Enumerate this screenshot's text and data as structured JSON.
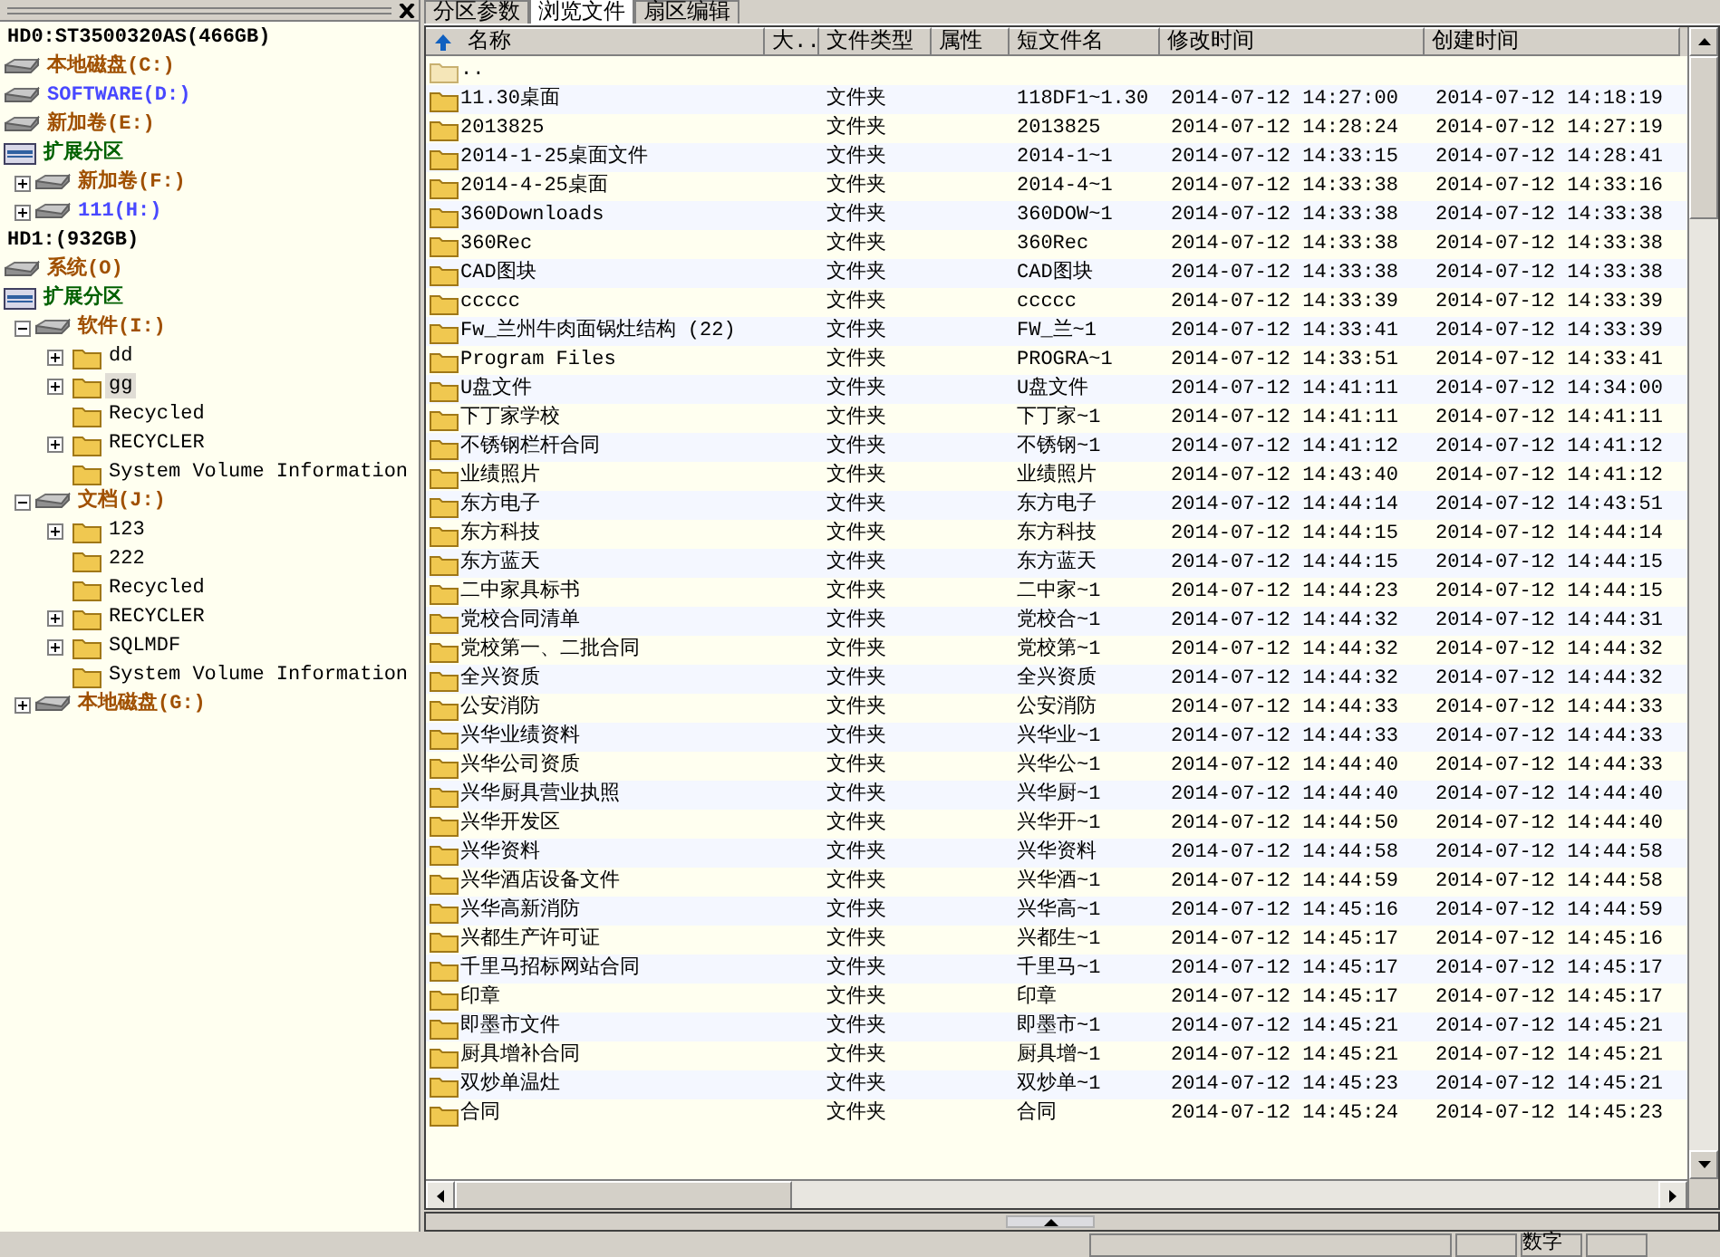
{
  "tree": {
    "items": [
      {
        "kind": "hdd",
        "label": "HD0:ST3500320AS(466GB)",
        "selected": false,
        "color": "#000000"
      },
      {
        "kind": "disk",
        "label": "本地磁盘(C:)",
        "selected": false,
        "color": "#a05000"
      },
      {
        "kind": "disk",
        "label": "SOFTWARE(D:)",
        "selected": false,
        "color": "#4848ff"
      },
      {
        "kind": "disk",
        "label": "新加卷(E:)",
        "selected": false,
        "color": "#a05000"
      },
      {
        "kind": "extended",
        "label": "扩展分区",
        "selected": false,
        "color": "#006000",
        "children": [
          {
            "kind": "disk",
            "label": "新加卷(F:)",
            "expanded": false,
            "selected": false,
            "color": "#a05000"
          },
          {
            "kind": "disk",
            "label": "111(H:)",
            "expanded": false,
            "selected": false,
            "color": "#4848ff"
          }
        ]
      },
      {
        "kind": "hdd",
        "label": "HD1:(932GB)",
        "selected": false,
        "color": "#000000"
      },
      {
        "kind": "disk",
        "label": "系统(O)",
        "selected": false,
        "color": "#a05000"
      },
      {
        "kind": "extended",
        "label": "扩展分区",
        "selected": false,
        "color": "#006000",
        "children": [
          {
            "kind": "disk",
            "label": "软件(I:)",
            "expanded": true,
            "selected": false,
            "color": "#a05000",
            "children": [
              {
                "kind": "folder",
                "label": "dd",
                "expanded": false,
                "selected": false,
                "color": "#000000"
              },
              {
                "kind": "folder",
                "label": "gg",
                "expanded": false,
                "selected": true,
                "color": "#000000"
              },
              {
                "kind": "folder",
                "label": "Recycled",
                "selected": false,
                "color": "#000000"
              },
              {
                "kind": "folder",
                "label": "RECYCLER",
                "expanded": false,
                "selected": false,
                "color": "#000000"
              },
              {
                "kind": "folder",
                "label": "System Volume Information",
                "selected": false,
                "color": "#000000"
              }
            ]
          },
          {
            "kind": "disk",
            "label": "文档(J:)",
            "expanded": true,
            "selected": false,
            "color": "#a05000",
            "children": [
              {
                "kind": "folder",
                "label": "123",
                "expanded": false,
                "selected": false,
                "color": "#000000"
              },
              {
                "kind": "folder",
                "label": "222",
                "selected": false,
                "color": "#000000"
              },
              {
                "kind": "folder",
                "label": "Recycled",
                "selected": false,
                "color": "#000000"
              },
              {
                "kind": "folder",
                "label": "RECYCLER",
                "expanded": false,
                "selected": false,
                "color": "#000000"
              },
              {
                "kind": "folder",
                "label": "SQLMDF",
                "expanded": false,
                "selected": false,
                "color": "#000000"
              },
              {
                "kind": "folder",
                "label": "System Volume Information",
                "selected": false,
                "color": "#000000"
              }
            ]
          },
          {
            "kind": "disk",
            "label": "本地磁盘(G:)",
            "expanded": false,
            "selected": false,
            "color": "#a05000"
          }
        ]
      }
    ]
  },
  "tabs": [
    {
      "label": "分区参数",
      "selected": false
    },
    {
      "label": "浏览文件",
      "selected": true
    },
    {
      "label": "扇区编辑",
      "selected": false
    }
  ],
  "table": {
    "columns": [
      "名称",
      "大..",
      "文件类型",
      "属性",
      "短文件名",
      "修改时间",
      "创建时间"
    ],
    "rows": [
      {
        "name": ".."
      },
      {
        "name": "11.30桌面",
        "type": "文件夹",
        "short": "118DF1~1.30",
        "modified": "2014-07-12 14:27:00",
        "created": "2014-07-12 14:18:19"
      },
      {
        "name": "2013825",
        "type": "文件夹",
        "short": "2013825",
        "modified": "2014-07-12 14:28:24",
        "created": "2014-07-12 14:27:19"
      },
      {
        "name": "2014-1-25桌面文件",
        "type": "文件夹",
        "short": "2014-1~1",
        "modified": "2014-07-12 14:33:15",
        "created": "2014-07-12 14:28:41"
      },
      {
        "name": "2014-4-25桌面",
        "type": "文件夹",
        "short": "2014-4~1",
        "modified": "2014-07-12 14:33:38",
        "created": "2014-07-12 14:33:16"
      },
      {
        "name": "360Downloads",
        "type": "文件夹",
        "short": "360DOW~1",
        "modified": "2014-07-12 14:33:38",
        "created": "2014-07-12 14:33:38"
      },
      {
        "name": "360Rec",
        "type": "文件夹",
        "short": "360Rec",
        "modified": "2014-07-12 14:33:38",
        "created": "2014-07-12 14:33:38"
      },
      {
        "name": "CAD图块",
        "type": "文件夹",
        "short": "CAD图块",
        "modified": "2014-07-12 14:33:38",
        "created": "2014-07-12 14:33:38"
      },
      {
        "name": "ccccc",
        "type": "文件夹",
        "short": "ccccc",
        "modified": "2014-07-12 14:33:39",
        "created": "2014-07-12 14:33:39"
      },
      {
        "name": "Fw_兰州牛肉面锅灶结构 (22)",
        "type": "文件夹",
        "short": "FW_兰~1",
        "modified": "2014-07-12 14:33:41",
        "created": "2014-07-12 14:33:39"
      },
      {
        "name": "Program Files",
        "type": "文件夹",
        "short": "PROGRA~1",
        "modified": "2014-07-12 14:33:51",
        "created": "2014-07-12 14:33:41"
      },
      {
        "name": "U盘文件",
        "type": "文件夹",
        "short": "U盘文件",
        "modified": "2014-07-12 14:41:11",
        "created": "2014-07-12 14:34:00"
      },
      {
        "name": "下丁家学校",
        "type": "文件夹",
        "short": "下丁家~1",
        "modified": "2014-07-12 14:41:11",
        "created": "2014-07-12 14:41:11"
      },
      {
        "name": "不锈钢栏杆合同",
        "type": "文件夹",
        "short": "不锈钢~1",
        "modified": "2014-07-12 14:41:12",
        "created": "2014-07-12 14:41:12"
      },
      {
        "name": "业绩照片",
        "type": "文件夹",
        "short": "业绩照片",
        "modified": "2014-07-12 14:43:40",
        "created": "2014-07-12 14:41:12"
      },
      {
        "name": "东方电子",
        "type": "文件夹",
        "short": "东方电子",
        "modified": "2014-07-12 14:44:14",
        "created": "2014-07-12 14:43:51"
      },
      {
        "name": "东方科技",
        "type": "文件夹",
        "short": "东方科技",
        "modified": "2014-07-12 14:44:15",
        "created": "2014-07-12 14:44:14"
      },
      {
        "name": "东方蓝天",
        "type": "文件夹",
        "short": "东方蓝天",
        "modified": "2014-07-12 14:44:15",
        "created": "2014-07-12 14:44:15"
      },
      {
        "name": "二中家具标书",
        "type": "文件夹",
        "short": "二中家~1",
        "modified": "2014-07-12 14:44:23",
        "created": "2014-07-12 14:44:15"
      },
      {
        "name": "党校合同清单",
        "type": "文件夹",
        "short": "党校合~1",
        "modified": "2014-07-12 14:44:32",
        "created": "2014-07-12 14:44:31"
      },
      {
        "name": "党校第一、二批合同",
        "type": "文件夹",
        "short": "党校第~1",
        "modified": "2014-07-12 14:44:32",
        "created": "2014-07-12 14:44:32"
      },
      {
        "name": "全兴资质",
        "type": "文件夹",
        "short": "全兴资质",
        "modified": "2014-07-12 14:44:32",
        "created": "2014-07-12 14:44:32"
      },
      {
        "name": "公安消防",
        "type": "文件夹",
        "short": "公安消防",
        "modified": "2014-07-12 14:44:33",
        "created": "2014-07-12 14:44:33"
      },
      {
        "name": "兴华业绩资料",
        "type": "文件夹",
        "short": "兴华业~1",
        "modified": "2014-07-12 14:44:33",
        "created": "2014-07-12 14:44:33"
      },
      {
        "name": "兴华公司资质",
        "type": "文件夹",
        "short": "兴华公~1",
        "modified": "2014-07-12 14:44:40",
        "created": "2014-07-12 14:44:33"
      },
      {
        "name": "兴华厨具营业执照",
        "type": "文件夹",
        "short": "兴华厨~1",
        "modified": "2014-07-12 14:44:40",
        "created": "2014-07-12 14:44:40"
      },
      {
        "name": "兴华开发区",
        "type": "文件夹",
        "short": "兴华开~1",
        "modified": "2014-07-12 14:44:50",
        "created": "2014-07-12 14:44:40"
      },
      {
        "name": "兴华资料",
        "type": "文件夹",
        "short": "兴华资料",
        "modified": "2014-07-12 14:44:58",
        "created": "2014-07-12 14:44:58"
      },
      {
        "name": "兴华酒店设备文件",
        "type": "文件夹",
        "short": "兴华酒~1",
        "modified": "2014-07-12 14:44:59",
        "created": "2014-07-12 14:44:58"
      },
      {
        "name": "兴华高新消防",
        "type": "文件夹",
        "short": "兴华高~1",
        "modified": "2014-07-12 14:45:16",
        "created": "2014-07-12 14:44:59"
      },
      {
        "name": "兴都生产许可证",
        "type": "文件夹",
        "short": "兴都生~1",
        "modified": "2014-07-12 14:45:17",
        "created": "2014-07-12 14:45:16"
      },
      {
        "name": "千里马招标网站合同",
        "type": "文件夹",
        "short": "千里马~1",
        "modified": "2014-07-12 14:45:17",
        "created": "2014-07-12 14:45:17"
      },
      {
        "name": "印章",
        "type": "文件夹",
        "short": "印章",
        "modified": "2014-07-12 14:45:17",
        "created": "2014-07-12 14:45:17"
      },
      {
        "name": "即墨市文件",
        "type": "文件夹",
        "short": "即墨市~1",
        "modified": "2014-07-12 14:45:21",
        "created": "2014-07-12 14:45:21"
      },
      {
        "name": "厨具增补合同",
        "type": "文件夹",
        "short": "厨具增~1",
        "modified": "2014-07-12 14:45:21",
        "created": "2014-07-12 14:45:21"
      },
      {
        "name": "双炒单温灶",
        "type": "文件夹",
        "short": "双炒单~1",
        "modified": "2014-07-12 14:45:23",
        "created": "2014-07-12 14:45:21"
      },
      {
        "name": "合同",
        "type": "文件夹",
        "short": "合同",
        "modified": "2014-07-12 14:45:24",
        "created": "2014-07-12 14:45:23"
      }
    ]
  },
  "status_bar": {
    "indicator": "数字"
  }
}
